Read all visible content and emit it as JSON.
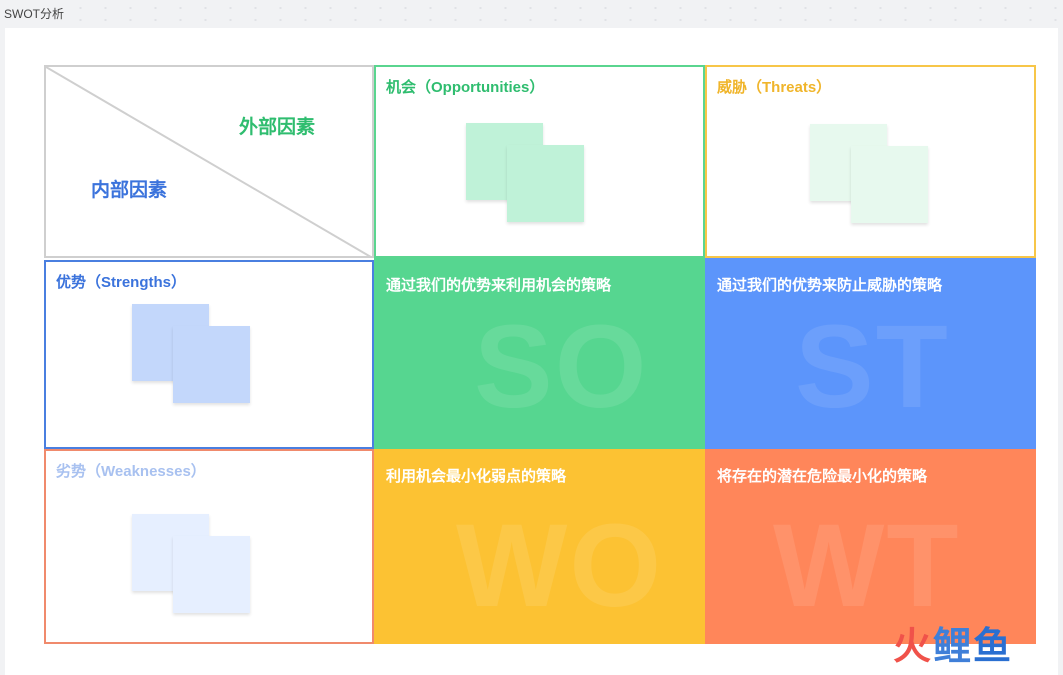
{
  "window": {
    "title": "SWOT分析"
  },
  "corner": {
    "external_label": "外部因素",
    "internal_label": "内部因素"
  },
  "headers": {
    "opportunities": {
      "label": "机会（Opportunities）",
      "color": "#5ad58f"
    },
    "threats": {
      "label": "威胁（Threats）",
      "color": "#f7c648"
    },
    "strengths": {
      "label": "优势（Strengths）",
      "color": "#4a7fe0"
    },
    "weaknesses": {
      "label": "劣势（Weaknesses）",
      "color": "#f08a6c"
    }
  },
  "quadrants": {
    "so": {
      "code": "SO",
      "text": "通过我们的优势来利用机会的策略",
      "color": "#56d690"
    },
    "st": {
      "code": "ST",
      "text": "通过我们的优势来防止威胁的策略",
      "color": "#5c95fb"
    },
    "wo": {
      "code": "WO",
      "text": "利用机会最小化弱点的策略",
      "color": "#fcc233"
    },
    "wt": {
      "code": "WT",
      "text": "将存在的潜在危险最小化的策略",
      "color": "#ff865a"
    }
  },
  "watermark_logo": {
    "part1": "火",
    "part2": "鲤",
    "part3": "鱼"
  }
}
